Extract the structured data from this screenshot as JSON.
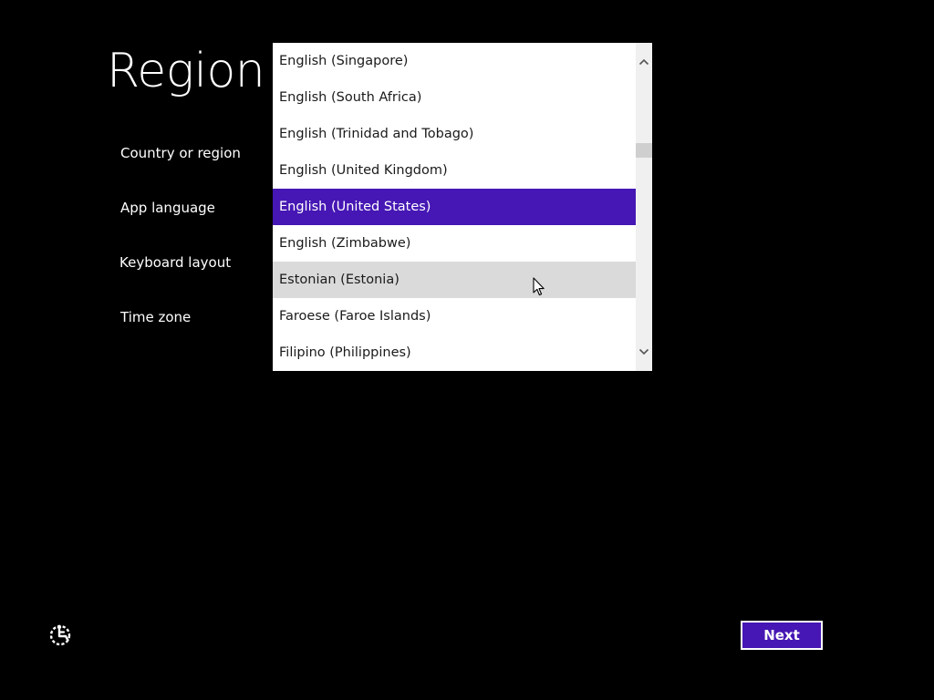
{
  "page": {
    "title": "Region"
  },
  "settings": {
    "country_label": "Country or region",
    "app_language_label": "App language",
    "keyboard_layout_label": "Keyboard layout",
    "time_zone_label": "Time zone"
  },
  "dropdown": {
    "options": [
      "English (Singapore)",
      "English (South Africa)",
      "English (Trinidad and Tobago)",
      "English (United Kingdom)",
      "English (United States)",
      "English (Zimbabwe)",
      "Estonian (Estonia)",
      "Faroese (Faroe Islands)",
      "Filipino (Philippines)"
    ],
    "selected_value": "English (United States)",
    "hovered_value": "Estonian (Estonia)"
  },
  "footer": {
    "next_label": "Next",
    "ease_of_access_icon": "ease-of-access-icon"
  },
  "colors": {
    "background": "#000000",
    "accent": "#4617b4",
    "selected_scroll_track": "#7b5cc9",
    "hover": "#dadada"
  }
}
